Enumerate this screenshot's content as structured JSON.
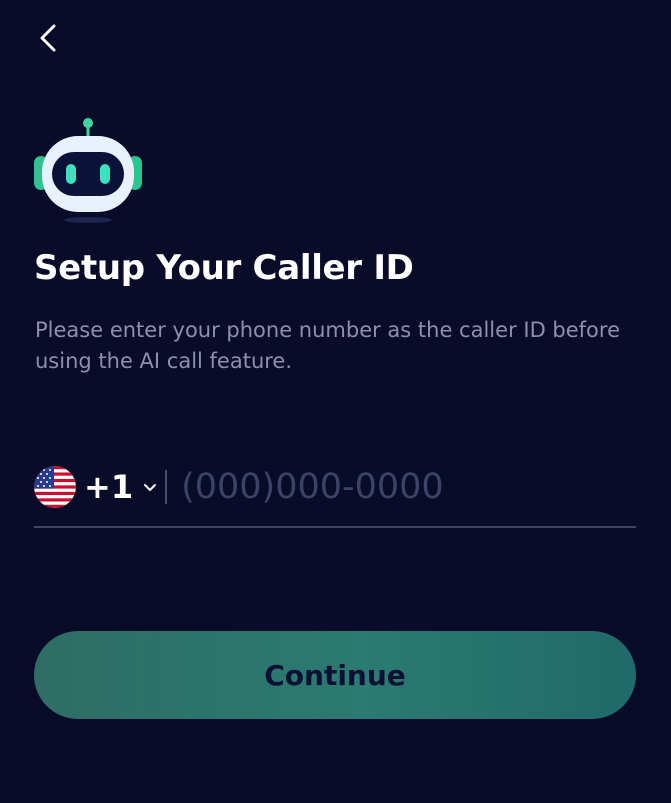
{
  "navigation": {
    "back_icon": "chevron-left-icon"
  },
  "header": {
    "logo_icon": "robot-icon",
    "title": "Setup Your Caller ID",
    "description": "Please enter your phone number as the caller ID before using the AI call feature."
  },
  "phone": {
    "country_flag_icon": "us-flag-icon",
    "dial_code": "+1",
    "dropdown_icon": "chevron-down-icon",
    "value": "",
    "placeholder": "(000)000-0000"
  },
  "actions": {
    "continue_label": "Continue"
  },
  "colors": {
    "background": "#080c28",
    "accent": "#2a7b71",
    "robot_green": "#3fd4a0",
    "muted_text": "#8c91ab"
  }
}
